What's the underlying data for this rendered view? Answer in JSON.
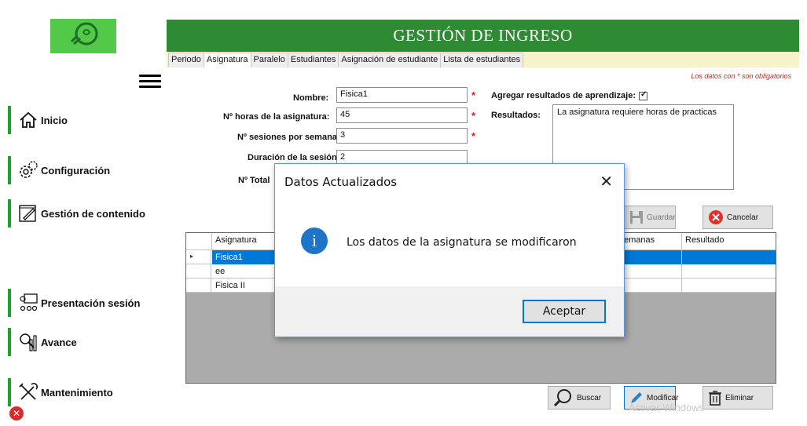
{
  "colors": {
    "brand_green": "#2f8a34",
    "accent_blue": "#0078d7",
    "required_red": "#d02020"
  },
  "sidebar": {
    "logo_icon": "lightbulb-logo-icon",
    "items": [
      {
        "label": "Inicio",
        "icon": "home-icon"
      },
      {
        "label": "Configuración",
        "icon": "gears-icon"
      },
      {
        "label": "Gestión de contenido",
        "icon": "edit-document-icon"
      },
      {
        "label": "Presentación sesión",
        "icon": "presentation-icon"
      },
      {
        "label": "Avance",
        "icon": "progress-chart-icon"
      },
      {
        "label": "Mantenimiento",
        "icon": "tools-icon"
      }
    ],
    "exit_symbol": "✕"
  },
  "header": {
    "title": "GESTIÓN DE INGRESO"
  },
  "tabs": [
    "Periodo",
    "Asignatura",
    "Paralelo",
    "Estudiantes",
    "Asignación de estudiante",
    "Lista de estudiantes"
  ],
  "form": {
    "required_note": "Los datos con * son obligatorios",
    "nombre_label": "Nombre:",
    "nombre_value": "Fisica1",
    "horas_label": "Nº horas de la asignatura:",
    "horas_value": "45",
    "sesiones_label": "Nº sesiones por semana:",
    "sesiones_value": "3",
    "duracion_label": "Duración de la sesión:",
    "duracion_value": "2",
    "total_label": "Nº Total",
    "asterisk": "*",
    "agregar_label": "Agregar resultados de aprendizaje:",
    "resultados_label": "Resultados:",
    "resultados_value": "La asignatura requiere horas de practicas"
  },
  "buttons": {
    "guardar": "Guardar",
    "cancelar": "Cancelar",
    "buscar": "Buscar",
    "modificar": "Modificar",
    "eliminar": "Eliminar"
  },
  "grid": {
    "columns": [
      "Asignatura",
      "emanas",
      "Resultado"
    ],
    "rows": [
      {
        "asignatura": "Fisica1",
        "selected": true
      },
      {
        "asignatura": "ee",
        "selected": false
      },
      {
        "asignatura": "Fisica II",
        "selected": false
      }
    ],
    "row_indicator": "▸"
  },
  "dialog": {
    "title": "Datos Actualizados",
    "message": "Los datos de la asignatura se modificaron",
    "ok_label": "Aceptar",
    "close_symbol": "✕",
    "info_symbol": "i"
  },
  "watermark": "Activar Windows"
}
